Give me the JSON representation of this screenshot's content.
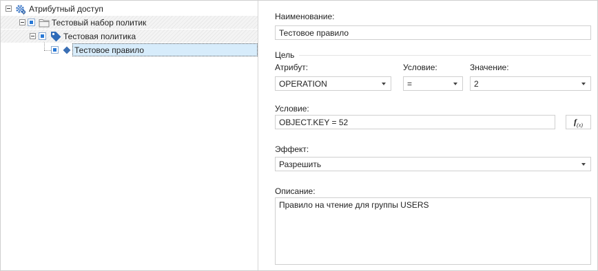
{
  "tree": {
    "root": {
      "label": "Атрибутный доступ",
      "icon": "gear-icon"
    },
    "set": {
      "label": "Тестовый набор политик",
      "icon": "folder-icon"
    },
    "policy": {
      "label": "Тестовая политика",
      "icon": "tag-icon"
    },
    "rule": {
      "label": "Тестовое правило",
      "icon": "diamond-icon"
    }
  },
  "form": {
    "name_label": "Наименование:",
    "name_value": "Тестовое правило",
    "target_label": "Цель",
    "attribute_label": "Атрибут:",
    "attribute_value": "OPERATION",
    "operator_label": "Условие:",
    "operator_value": "=",
    "value_label": "Значение:",
    "value_value": "2",
    "condition_label": "Условие:",
    "condition_value": "OBJECT.KEY = 52",
    "fx_label": "f",
    "fx_sub": "(x)",
    "effect_label": "Эффект:",
    "effect_value": "Разрешить",
    "description_label": "Описание:",
    "description_value": "Правило на чтение для группы USERS"
  }
}
